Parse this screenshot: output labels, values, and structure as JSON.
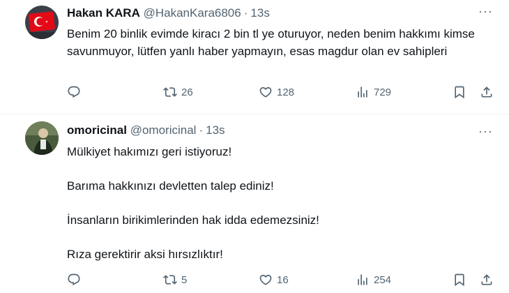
{
  "tweets": [
    {
      "name": "Hakan KARA",
      "handle": "@HakanKara6806",
      "time": "13s",
      "text": "Benim 20 binlik evimde kiracı 2 bin tl ye oturuyor, neden benim hakkımı kimse savunmuyor, lütfen yanlı haber yapmayın, esas magdur olan ev sahipleri",
      "retweets": "26",
      "likes": "128",
      "views": "729"
    },
    {
      "name": "omoricinal",
      "handle": "@omoricinal",
      "time": "13s",
      "paragraphs": [
        "Mülkiyet hakımızı geri istiyoruz!",
        "Barıma hakkınızı devletten talep ediniz!",
        "İnsanların birikimlerinden hak idda edemezsiniz!",
        "Rıza gerektirir aksi hırsızlıktır!"
      ],
      "retweets": "5",
      "likes": "16",
      "views": "254"
    }
  ],
  "icons": {
    "reply": "reply-icon",
    "retweet": "retweet-icon",
    "like": "like-icon",
    "views": "views-icon",
    "bookmark": "bookmark-icon",
    "share": "share-icon",
    "more": "more-icon"
  },
  "more_glyph": "···",
  "colors": {
    "icon": "#536471",
    "text": "#0f1419",
    "divider": "#eff3f4"
  }
}
